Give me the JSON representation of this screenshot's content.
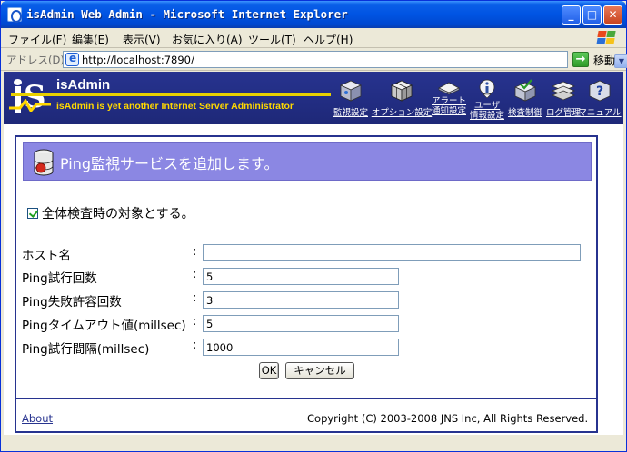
{
  "window": {
    "title": "isAdmin Web Admin - Microsoft Internet Explorer",
    "min_glyph": "_",
    "max_glyph": "□",
    "close_glyph": "✕"
  },
  "menubar": {
    "items": [
      "ファイル(F)",
      "編集(E)",
      "表示(V)",
      "お気に入り(A)",
      "ツール(T)",
      "ヘルプ(H)"
    ]
  },
  "addressbar": {
    "label": "アドレス(D)",
    "url": "http://localhost:7890/",
    "go_label": "移動"
  },
  "banner": {
    "title": "isAdmin",
    "subtitle": "isAdmin is yet another Internet Server Administrator",
    "nav": [
      {
        "label": "監視設定",
        "icon": "monitor-box-icon"
      },
      {
        "label": "オプション設定",
        "icon": "cube-options-icon"
      },
      {
        "label": "アラート\n通知設定",
        "icon": "alert-envelope-icon"
      },
      {
        "label": "ユーザ\n情報設定",
        "icon": "user-info-icon"
      },
      {
        "label": "検査制御",
        "icon": "check-box-icon"
      },
      {
        "label": "ログ管理",
        "icon": "log-stack-icon"
      },
      {
        "label": "マニュアル",
        "icon": "help-manual-icon"
      }
    ]
  },
  "content": {
    "heading": "Ping監視サービスを追加します。",
    "include_in_full_check": {
      "label": "全体検査時の対象とする。",
      "checked": true
    },
    "form": {
      "colon": ":",
      "fields": [
        {
          "label": "ホスト名",
          "value": ""
        },
        {
          "label": "Ping試行回数",
          "value": "5"
        },
        {
          "label": "Ping失敗許容回数",
          "value": "3"
        },
        {
          "label": "Pingタイムアウト値(millsec)",
          "value": "5"
        },
        {
          "label": "Ping試行間隔(millsec)",
          "value": "1000"
        }
      ]
    },
    "ok_label": "OK",
    "cancel_label": "キャンセル"
  },
  "footer": {
    "about": "About",
    "copyright": "Copyright (C) 2003-2008 JNS Inc, All Rights Reserved."
  },
  "colors": {
    "banner_bg": "#27338f",
    "heading_bg": "#8b87e3",
    "accent_yellow": "#ffd800"
  }
}
